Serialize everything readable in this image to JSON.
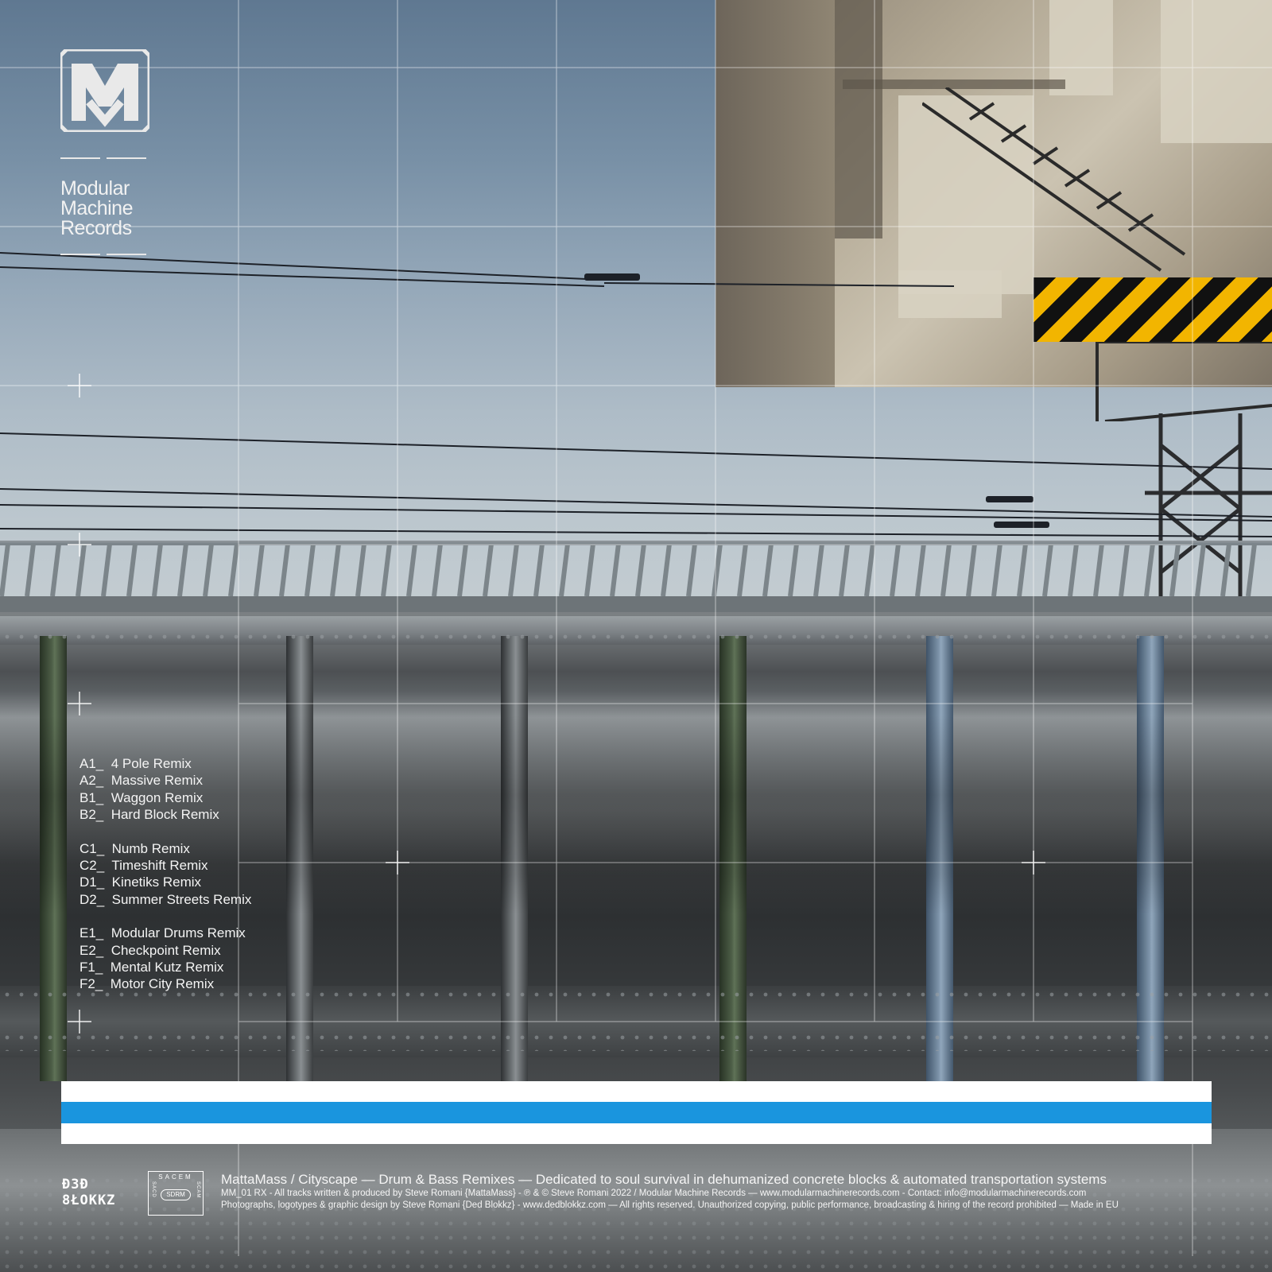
{
  "label": {
    "name_lines": [
      "Modular",
      "Machine",
      "Records"
    ]
  },
  "tracklist": [
    [
      {
        "code": "A1_",
        "title": "4 Pole Remix"
      },
      {
        "code": "A2_",
        "title": "Massive Remix"
      },
      {
        "code": "B1_",
        "title": "Waggon Remix"
      },
      {
        "code": "B2_",
        "title": "Hard Block Remix"
      }
    ],
    [
      {
        "code": "C1_",
        "title": "Numb Remix"
      },
      {
        "code": "C2_",
        "title": "Timeshift Remix"
      },
      {
        "code": "D1_",
        "title": "Kinetiks Remix"
      },
      {
        "code": "D2_",
        "title": "Summer Streets Remix"
      }
    ],
    [
      {
        "code": "E1_",
        "title": "Modular Drums Remix"
      },
      {
        "code": "E2_",
        "title": "Checkpoint Remix"
      },
      {
        "code": "F1_",
        "title": "Mental Kutz Remix"
      },
      {
        "code": "F2_",
        "title": "Motor City Remix"
      }
    ]
  ],
  "footer": {
    "brand_line1": "Ð3Ð",
    "brand_line2": "8ŁOKKZ",
    "sacem_top": "SACEM",
    "sacem_mid": "SDRM",
    "sacem_left": "SACD",
    "sacem_right": "SCAM",
    "line1": "MattaMass / Cityscape — Drum & Bass Remixes — Dedicated to soul survival in dehumanized concrete blocks & automated transportation systems",
    "line2": "MM_01 RX - All tracks written & produced by Steve Romani {MattaMass} - ℗ & © Steve Romani 2022 / Modular Machine Records — www.modularmachinerecords.com - Contact: info@modularmachinerecords.com",
    "line3": "Photographs, logotypes & graphic design by Steve Romani {Ded Blokkz} - www.dedblokkz.com — All rights reserved. Unauthorized copying, public performance, broadcasting & hiring of the record prohibited — Made in EU"
  },
  "colors": {
    "accent_blue": "#1a95de",
    "hazard_yellow": "#f2b500",
    "hazard_black": "#111111"
  }
}
